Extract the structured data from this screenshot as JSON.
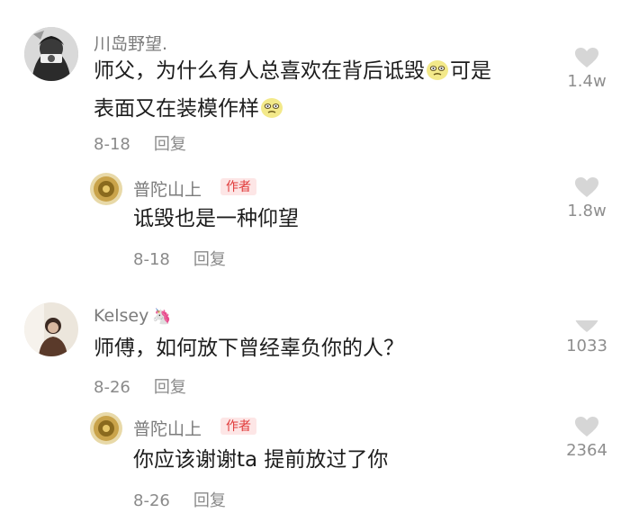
{
  "comments": [
    {
      "username": "川岛野望.",
      "text_line1": "师父，为什么有人总喜欢在背后诋毁",
      "text_line1_tail": "可是",
      "text_line2": "表面又在装模作样",
      "date": "8-18",
      "reply_label": "回复",
      "likes": "1.4w",
      "emoji": "squinting-face-emoji"
    },
    {
      "username": "普陀山上",
      "badge": "作者",
      "text": "诋毁也是一种仰望",
      "date": "8-18",
      "reply_label": "回复",
      "likes": "1.8w"
    },
    {
      "username": "Kelsey",
      "username_icon": "🦄",
      "text": "师傅，如何放下曾经辜负你的人？",
      "date": "8-26",
      "reply_label": "回复",
      "likes": "1033"
    },
    {
      "username": "普陀山上",
      "badge": "作者",
      "text": "你应该谢谢ta 提前放过了你",
      "date": "8-26",
      "reply_label": "回复",
      "likes": "2364"
    }
  ],
  "colors": {
    "username": "#7b7b7b",
    "text": "#1d1d1d",
    "meta": "#8a8a8a",
    "badge_bg": "#fde6e6",
    "badge_text": "#e03a3a",
    "like_icon": "#d6d6d6"
  }
}
